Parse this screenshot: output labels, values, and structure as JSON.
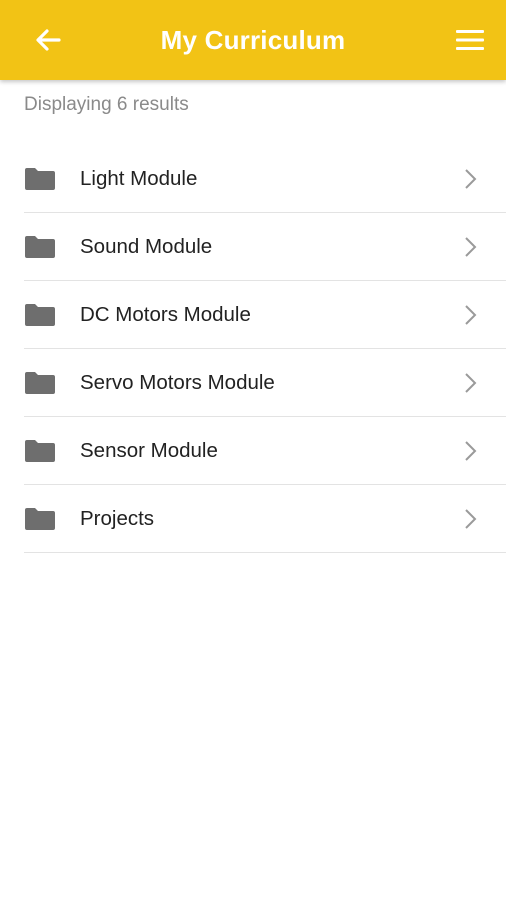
{
  "appbar": {
    "title": "My Curriculum",
    "back_icon": "arrow-left-icon",
    "menu_icon": "hamburger-menu-icon",
    "color": "#f2c315"
  },
  "results": {
    "count_text": "Displaying 6 results"
  },
  "items": [
    {
      "label": "Light Module",
      "icon": "folder-icon"
    },
    {
      "label": "Sound Module",
      "icon": "folder-icon"
    },
    {
      "label": "DC Motors Module",
      "icon": "folder-icon"
    },
    {
      "label": "Servo Motors Module",
      "icon": "folder-icon"
    },
    {
      "label": "Sensor Module",
      "icon": "folder-icon"
    },
    {
      "label": "Projects",
      "icon": "folder-icon"
    }
  ]
}
